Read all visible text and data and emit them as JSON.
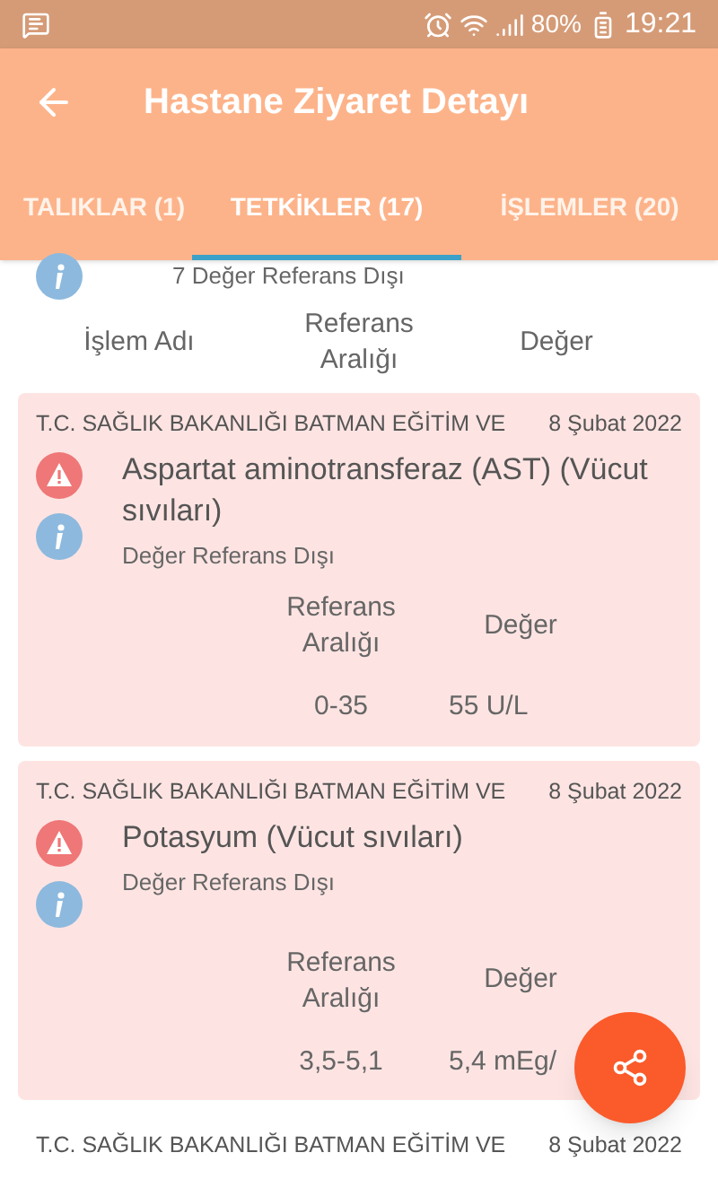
{
  "status_bar": {
    "battery": "80%",
    "time": "19:21"
  },
  "app_bar": {
    "title": "Hastane Ziyaret Detayı"
  },
  "tabs": [
    {
      "label": "TALIKLAR (1)",
      "selected": false
    },
    {
      "label": "TETKİKLER (17)",
      "selected": true
    },
    {
      "label": "İŞLEMLER (20)",
      "selected": false
    }
  ],
  "summary": {
    "note": "7 Değer Referans Dışı"
  },
  "column_headers": [
    "İşlem Adı",
    "Referans Aralığı",
    "Değer"
  ],
  "results": [
    {
      "kind": "abnormal",
      "institution": "T.C. SAĞLIK BAKANLIĞI BATMAN EĞİTİM VE",
      "date": "8 Şubat 2022",
      "name": "Aspartat aminotransferaz (AST) (Vücut sıvıları)",
      "note": "Değer Referans Dışı",
      "range_label": "Referans Aralığı",
      "value_label": "Değer",
      "range": "0-35",
      "value": "55 U/L"
    },
    {
      "kind": "abnormal",
      "institution": "T.C. SAĞLIK BAKANLIĞI BATMAN EĞİTİM VE",
      "date": "8 Şubat 2022",
      "name": "Potasyum (Vücut sıvıları)",
      "note": "Değer Referans Dışı",
      "range_label": "Referans Aralığı",
      "value_label": "Değer",
      "range": "3,5-5,1",
      "value": "5,4 mEg/"
    },
    {
      "kind": "normal",
      "institution": "T.C. SAĞLIK BAKANLIĞI BATMAN EĞİTİM VE",
      "date": "8 Şubat 2022"
    }
  ]
}
